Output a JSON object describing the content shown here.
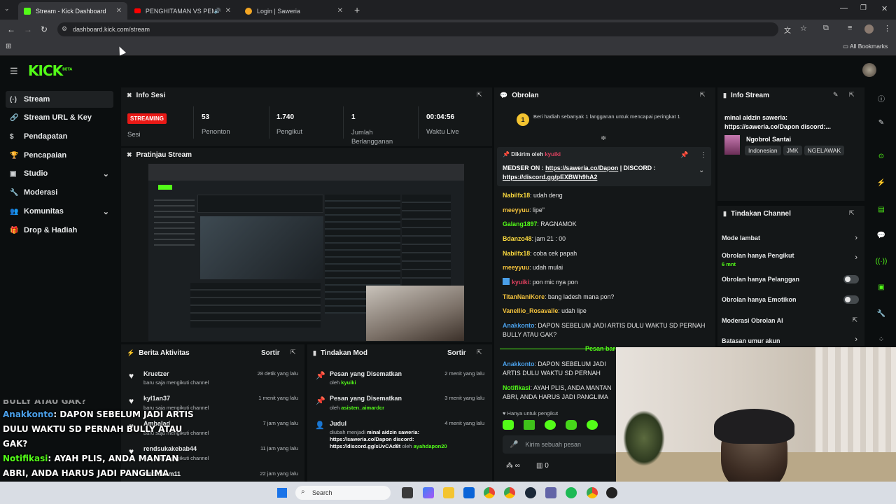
{
  "browser": {
    "tabs": [
      {
        "title": "Stream - Kick Dashboard",
        "active": true
      },
      {
        "title": "PENGHITAMAN VS PEMUTI",
        "active": false
      },
      {
        "title": "Login | Saweria",
        "active": false
      }
    ],
    "url": "dashboard.kick.com/stream",
    "bookmarks_label": "All Bookmarks"
  },
  "app": {
    "logo": "KICK",
    "logo_badge": "BETA",
    "sidebar": [
      {
        "label": "Stream",
        "icon": "stream-icon"
      },
      {
        "label": "Stream URL & Key",
        "icon": "link-icon"
      },
      {
        "label": "Pendapatan",
        "icon": "money-icon"
      },
      {
        "label": "Pencapaian",
        "icon": "trophy-icon"
      },
      {
        "label": "Studio",
        "icon": "studio-icon"
      },
      {
        "label": "Moderasi",
        "icon": "wrench-icon"
      },
      {
        "label": "Komunitas",
        "icon": "community-icon"
      },
      {
        "label": "Drop & Hadiah",
        "icon": "gift-icon"
      }
    ]
  },
  "session": {
    "title": "Info Sesi",
    "status": "STREAMING",
    "status_label": "Sesi",
    "stats": [
      {
        "value": "53",
        "label": "Penonton"
      },
      {
        "value": "1.740",
        "label": "Pengikut"
      },
      {
        "value": "1",
        "label": "Jumlah Berlangganan"
      },
      {
        "value": "00:04:56",
        "label": "Waktu Live"
      }
    ]
  },
  "preview": {
    "title": "Pratinjau Stream"
  },
  "activity": {
    "title": "Berita Aktivitas",
    "sort": "Sortir",
    "items": [
      {
        "name": "Kruetzer",
        "desc": "baru saja mengikuti channel",
        "time": "28 detik yang lalu"
      },
      {
        "name": "kyl1an37",
        "desc": "baru saja mengikuti channel",
        "time": "1 menit yang lalu"
      },
      {
        "name": "Ambalad",
        "desc": "baru saja mengikuti channel",
        "time": "7 jam yang lalu"
      },
      {
        "name": "rendsukakebab44",
        "desc": "baru saja mengikuti channel",
        "time": "11 jam yang lalu"
      },
      {
        "name": "Andhikam11",
        "desc": "",
        "time": "22 jam yang lalu"
      }
    ]
  },
  "modactions": {
    "title": "Tindakan Mod",
    "sort": "Sortir",
    "items": [
      {
        "title": "Pesan yang Disematkan",
        "by": "oleh",
        "user": "kyuiki",
        "time": "2 menit yang lalu"
      },
      {
        "title": "Pesan yang Disematkan",
        "by": "oleh",
        "user": "asisten_aimardcr",
        "time": "3 menit yang lalu"
      },
      {
        "title": "Judul",
        "line1": "diubah menjadi",
        "line1b": "minal aidzin saweria:",
        "line2": "https://saweria.co/Dapon discord:",
        "line3": "https://discord.gg/sUvCAd8t",
        "by": "oleh",
        "user": "ayahdapon20",
        "time": "4 menit yang lalu"
      }
    ]
  },
  "chat": {
    "title": "Obrolan",
    "gift_notice": "Beri hadiah sebanyak 1 langganan untuk mencapai peringkat 1",
    "gift_rank": "1",
    "pinned_by": "Dikirim oleh",
    "pinned_user": "kyuiki",
    "pinned_text1": "MEDSER ON :",
    "pinned_link1": "https://saweria.co/Dapon",
    "pinned_sep": "| DISCORD :",
    "pinned_link2": "https://discord.gg/pEXBWh9hA2",
    "messages": [
      {
        "user": "Nabilfx18",
        "color": "#fbda3f",
        "text": "udah deng"
      },
      {
        "user": "meeyyuu",
        "color": "#f3c23d",
        "text": "lipe\""
      },
      {
        "user": "Galang1897",
        "color": "#53fc18",
        "text": "RAGNAMOK"
      },
      {
        "user": "Bdanzo48",
        "color": "#fbda3f",
        "text": "jam 21 : 00"
      },
      {
        "user": "Nabilfx18",
        "color": "#fbda3f",
        "text": "coba cek papah"
      },
      {
        "user": "meeyyuu",
        "color": "#f3c23d",
        "text": "udah mulai"
      },
      {
        "user": "kyuiki",
        "color": "#e0415f",
        "text": "pon mic nya pon"
      },
      {
        "user": "TitanNaniKore",
        "color": "#f3c23d",
        "text": "bang ladesh mana pon?"
      },
      {
        "user": "Vanellio_Rosavalle",
        "color": "#f3c23d",
        "text": "udah lipe"
      },
      {
        "user": "Anakkonto",
        "color": "#4a9fe8",
        "text": "DAPON SEBELUM JADI ARTIS DULU WAKTU SD PERNAH BULLY ATAU GAK?"
      }
    ],
    "divider": "Pesan bar",
    "after": [
      {
        "user": "Anakkonto",
        "color": "#4a9fe8",
        "text": "DAPON SEBELUM JADI ARTIS DULU WAKTU SD PERNAH BULLY ATAU GAK?"
      },
      {
        "user": "Notifikasi",
        "color": "#53fc18",
        "text": "AYAH PLIS, ANDA MANTAN ABRI, ANDA HARUS JADI PANGLIMA RAGNAMOK MALAM INI"
      }
    ],
    "followers_only": "Hanya untuk pengikut",
    "input_placeholder": "Kirim sebuah pesan",
    "points": "0"
  },
  "streaminfo": {
    "title": "Info Stream",
    "stream_title": "minal aidzin saweria: https://saweria.co/Dapon discord:...",
    "category": "Ngobrol Santai",
    "tags": [
      "Indonesian",
      "JMK",
      "NGELAWAK"
    ]
  },
  "channel_actions": {
    "title": "Tindakan Channel",
    "items": [
      {
        "label": "Mode lambat",
        "sub": "",
        "control": "chevron"
      },
      {
        "label": "Obrolan hanya Pengikut",
        "sub": "6 mnt",
        "control": "chevron"
      },
      {
        "label": "Obrolan hanya Pelanggan",
        "sub": "",
        "control": "toggle"
      },
      {
        "label": "Obrolan hanya Emotikon",
        "sub": "",
        "control": "toggle"
      },
      {
        "label": "Moderasi Obrolan AI",
        "sub": "",
        "control": "external"
      },
      {
        "label": "Batasan umur akun",
        "sub": "",
        "control": "chevron"
      }
    ]
  },
  "overlay": {
    "lines": [
      {
        "user": "Anakkonto",
        "text": "DAPON SEBELUM JADI ARTIS DULU WAKTU SD PERNAH BULLY ATAU GAK?"
      },
      {
        "user": "Notifikasi",
        "text": "AYAH PLIS, ANDA MANTAN ABRI, ANDA HARUS JADI PANGLIMA RAGNAMOK MALAM INI"
      }
    ],
    "top_fragment": "BULLY ATAU GAK?"
  },
  "taskbar": {
    "search": "Search"
  },
  "colors": {
    "brand": "#53fc18",
    "streaming": "#e91916"
  }
}
